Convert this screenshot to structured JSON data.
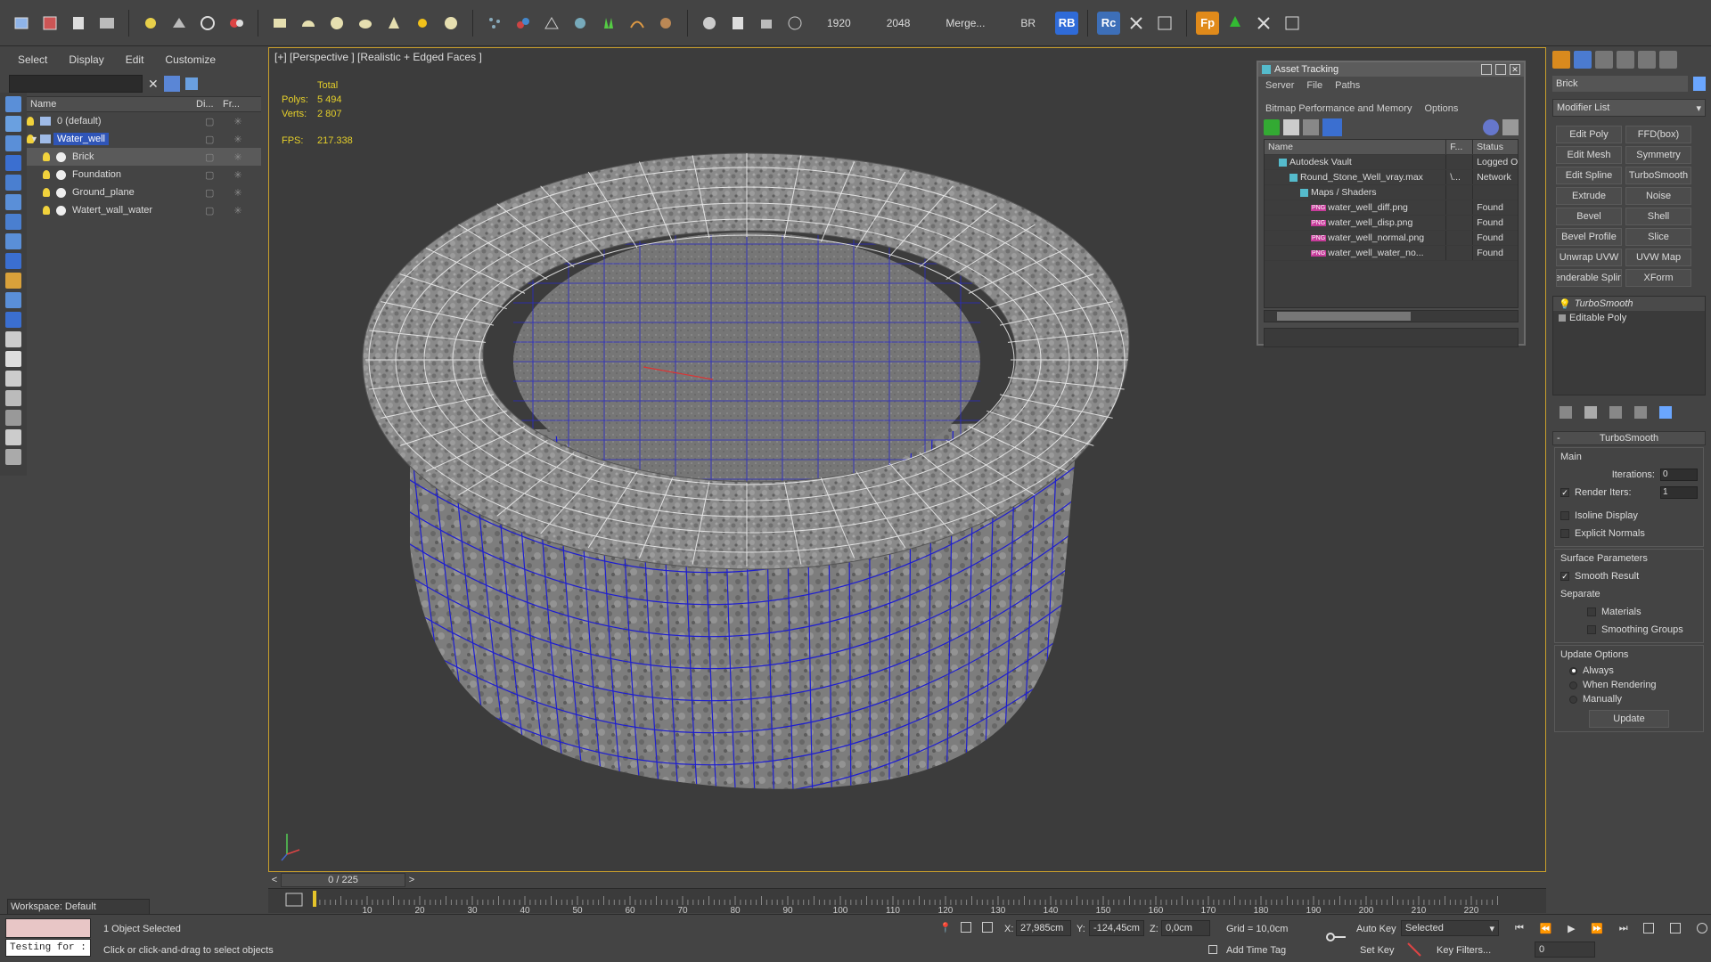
{
  "toolbar": {
    "resolution_w": "1920",
    "resolution_h": "2048",
    "merge_label": "Merge...",
    "br_label": "BR",
    "rb_badge": "RB",
    "rc_badge": "Rc",
    "fp_badge": "Fp"
  },
  "scene_explorer": {
    "menu": [
      "Select",
      "Display",
      "Edit",
      "Customize"
    ],
    "search_placeholder": "",
    "col_name": "Name",
    "col_display": "Di...",
    "col_freeze": "Fr...",
    "items": [
      {
        "label": "0 (default)",
        "level": 0,
        "type": "layer"
      },
      {
        "label": "Water_well",
        "level": 0,
        "type": "layer",
        "selected": true
      },
      {
        "label": "Brick",
        "level": 1,
        "type": "object",
        "highlight": true
      },
      {
        "label": "Foundation",
        "level": 1,
        "type": "object"
      },
      {
        "label": "Ground_plane",
        "level": 1,
        "type": "object"
      },
      {
        "label": "Watert_wall_water",
        "level": 1,
        "type": "object"
      }
    ],
    "workspace": "Workspace: Default"
  },
  "viewport": {
    "label": "[+] [Perspective ] [Realistic + Edged Faces ]",
    "stats_total": "Total",
    "polys_label": "Polys:",
    "polys_value": "5 494",
    "verts_label": "Verts:",
    "verts_value": "2 807",
    "fps_label": "FPS:",
    "fps_value": "217.338"
  },
  "asset_tracking": {
    "title": "Asset Tracking",
    "menu": [
      "Server",
      "File",
      "Paths",
      "Bitmap Performance and Memory",
      "Options"
    ],
    "col_name": "Name",
    "col_f": "F...",
    "col_status": "Status",
    "rows": [
      {
        "name": "Autodesk Vault",
        "f": "",
        "status": "Logged O",
        "indent": 1,
        "png": false
      },
      {
        "name": "Round_Stone_Well_vray.max",
        "f": "\\...",
        "status": "Network",
        "indent": 2,
        "png": false
      },
      {
        "name": "Maps / Shaders",
        "f": "",
        "status": "",
        "indent": 3,
        "png": false
      },
      {
        "name": "water_well_diff.png",
        "f": "",
        "status": "Found",
        "indent": 4,
        "png": true
      },
      {
        "name": "water_well_disp.png",
        "f": "",
        "status": "Found",
        "indent": 4,
        "png": true
      },
      {
        "name": "water_well_normal.png",
        "f": "",
        "status": "Found",
        "indent": 4,
        "png": true
      },
      {
        "name": "water_well_water_no...",
        "f": "",
        "status": "Found",
        "indent": 4,
        "png": true
      }
    ]
  },
  "command_panel": {
    "object_name": "Brick",
    "modifier_list": "Modifier List",
    "modifiers": [
      "Edit Poly",
      "FFD(box)",
      "Edit Mesh",
      "Symmetry",
      "Edit Spline",
      "TurboSmooth",
      "Extrude",
      "Noise",
      "Bevel",
      "Shell",
      "Bevel Profile",
      "Slice",
      "Unwrap UVW",
      "UVW Map",
      "enderable Splin",
      "XForm"
    ],
    "stack": [
      "TurboSmooth",
      "Editable Poly"
    ],
    "rollout_title": "TurboSmooth",
    "main_group": "Main",
    "iterations_label": "Iterations:",
    "iterations_value": "0",
    "render_iters_label": "Render Iters:",
    "render_iters_value": "1",
    "isoline_label": "Isoline Display",
    "explicit_normals_label": "Explicit Normals",
    "surface_group": "Surface Parameters",
    "smooth_result_label": "Smooth Result",
    "separate_label": "Separate",
    "materials_label": "Materials",
    "smoothing_groups_label": "Smoothing Groups",
    "update_group": "Update Options",
    "always_label": "Always",
    "when_rendering_label": "When Rendering",
    "manually_label": "Manually",
    "update_button": "Update"
  },
  "timeline": {
    "frame_display": "0 / 225",
    "progress": 0,
    "ticks": [
      "10",
      "20",
      "30",
      "40",
      "50",
      "60",
      "70",
      "80",
      "90",
      "100",
      "110",
      "120",
      "130",
      "140",
      "150",
      "160",
      "170",
      "180",
      "190",
      "200",
      "210",
      "220"
    ]
  },
  "status_bar": {
    "script_text": "Testing for :",
    "selected_text": "1 Object Selected",
    "prompt_text": "Click or click-and-drag to select objects",
    "x_label": "X:",
    "x_value": "27,985cm",
    "y_label": "Y:",
    "y_value": "-124,45cm",
    "z_label": "Z:",
    "z_value": "0,0cm",
    "grid_text": "Grid = 10,0cm",
    "add_time_tag": "Add Time Tag",
    "auto_key": "Auto Key",
    "set_key": "Set Key",
    "selected_dropdown": "Selected",
    "key_filters": "Key Filters...",
    "frame_value": "0"
  },
  "colors": {
    "accent_select": "#2f55b8",
    "viewport_border": "#c99f2b",
    "stats_yellow": "#e6d02a"
  }
}
